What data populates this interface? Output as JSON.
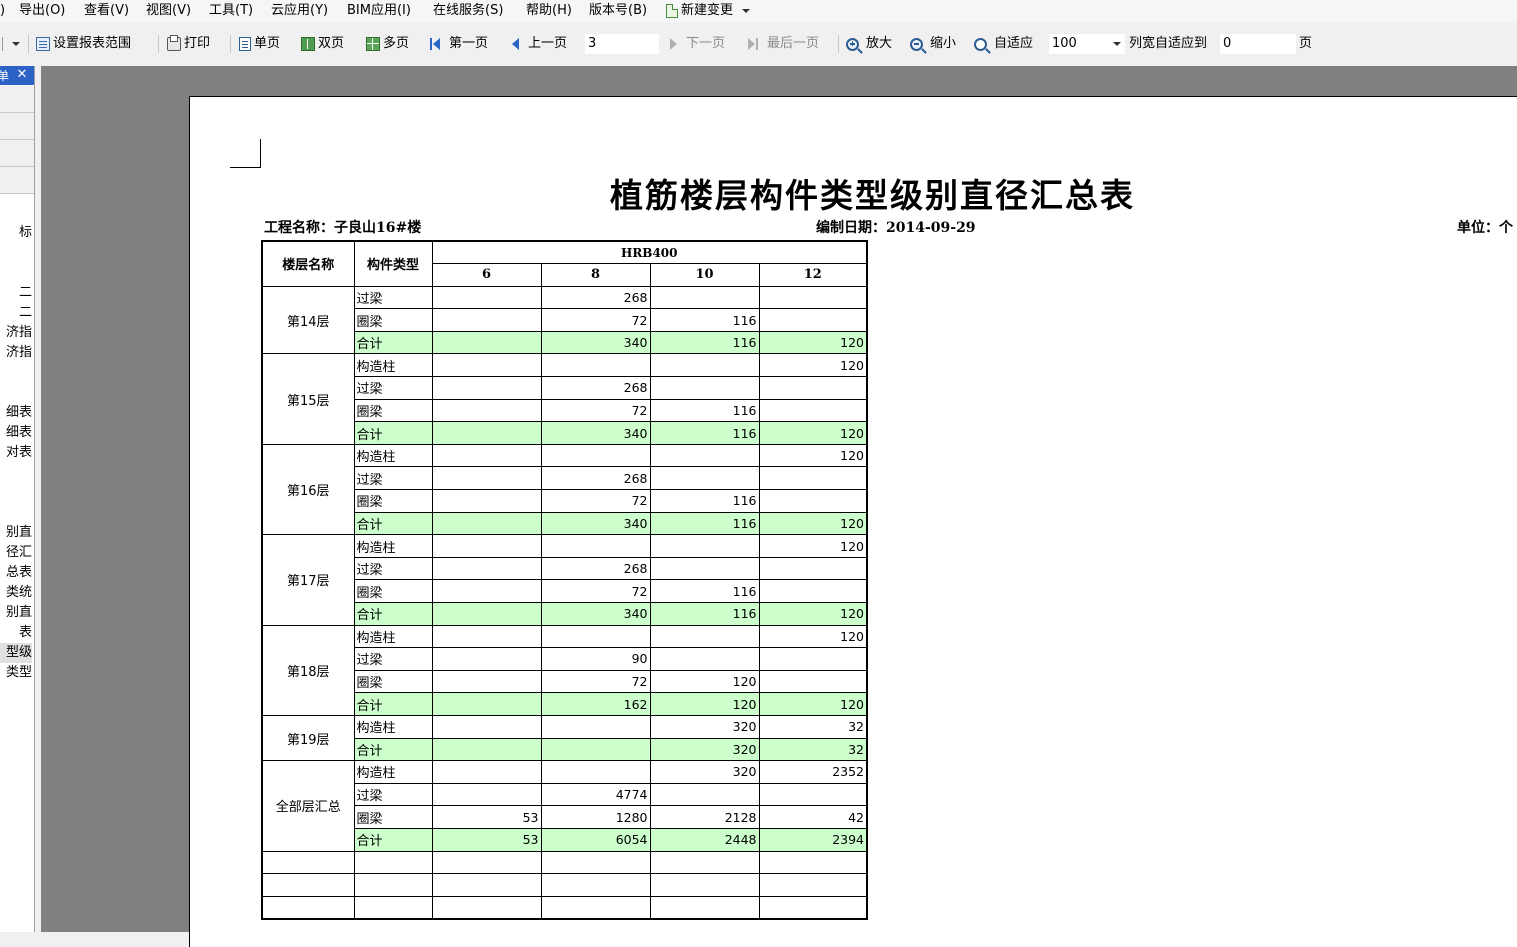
{
  "menu": [
    "导出(O)",
    "查看(V)",
    "视图(V)",
    "工具(T)",
    "云应用(Y)",
    "BIM应用(I)",
    "在线服务(S)",
    "帮助(H)",
    "版本号(B)",
    "新建变更"
  ],
  "menu_lead": ")",
  "toolbar": {
    "set_range": "设置报表范围",
    "print": "打印",
    "single": "单页",
    "double": "双页",
    "multi": "多页",
    "first": "第一页",
    "prev": "上一页",
    "page_value": "3",
    "next": "下一页",
    "last": "最后一页",
    "zoom_in": "放大",
    "zoom_out": "缩小",
    "fit": "自适应",
    "zoom_value": "100",
    "col_fit": "列宽自适应到",
    "col_fit_value": "0",
    "page_unit": "页"
  },
  "left_panel": {
    "title": "单",
    "close_icon": "close-icon",
    "items": [
      "标",
      "二",
      "二",
      "济指",
      "济指",
      "细表",
      "细表",
      "对表",
      "别直",
      "径汇",
      "总表",
      "类统",
      "别直",
      "表",
      "型级",
      "类型"
    ]
  },
  "report": {
    "title": "植筋楼层构件类型级别直径汇总表",
    "project_label": "工程名称：子良山16#楼",
    "date_label": "编制日期：2014-09-29",
    "unit_label": "单位：个",
    "headers": {
      "floor": "楼层名称",
      "type": "构件类型",
      "grade": "HRB400",
      "diameters": [
        "6",
        "8",
        "10",
        "12"
      ]
    },
    "groups": [
      {
        "floor": "第14层",
        "rows": [
          {
            "type": "过梁",
            "values": [
              "",
              "268",
              "",
              ""
            ],
            "sum": false
          },
          {
            "type": "圈梁",
            "values": [
              "",
              "72",
              "116",
              ""
            ],
            "sum": false
          },
          {
            "type": "合计",
            "values": [
              "",
              "340",
              "116",
              "120"
            ],
            "sum": true
          }
        ]
      },
      {
        "floor": "第15层",
        "rows": [
          {
            "type": "构造柱",
            "values": [
              "",
              "",
              "",
              "120"
            ],
            "sum": false
          },
          {
            "type": "过梁",
            "values": [
              "",
              "268",
              "",
              ""
            ],
            "sum": false
          },
          {
            "type": "圈梁",
            "values": [
              "",
              "72",
              "116",
              ""
            ],
            "sum": false
          },
          {
            "type": "合计",
            "values": [
              "",
              "340",
              "116",
              "120"
            ],
            "sum": true
          }
        ]
      },
      {
        "floor": "第16层",
        "rows": [
          {
            "type": "构造柱",
            "values": [
              "",
              "",
              "",
              "120"
            ],
            "sum": false
          },
          {
            "type": "过梁",
            "values": [
              "",
              "268",
              "",
              ""
            ],
            "sum": false
          },
          {
            "type": "圈梁",
            "values": [
              "",
              "72",
              "116",
              ""
            ],
            "sum": false
          },
          {
            "type": "合计",
            "values": [
              "",
              "340",
              "116",
              "120"
            ],
            "sum": true
          }
        ]
      },
      {
        "floor": "第17层",
        "rows": [
          {
            "type": "构造柱",
            "values": [
              "",
              "",
              "",
              "120"
            ],
            "sum": false
          },
          {
            "type": "过梁",
            "values": [
              "",
              "268",
              "",
              ""
            ],
            "sum": false
          },
          {
            "type": "圈梁",
            "values": [
              "",
              "72",
              "116",
              ""
            ],
            "sum": false
          },
          {
            "type": "合计",
            "values": [
              "",
              "340",
              "116",
              "120"
            ],
            "sum": true
          }
        ]
      },
      {
        "floor": "第18层",
        "rows": [
          {
            "type": "构造柱",
            "values": [
              "",
              "",
              "",
              "120"
            ],
            "sum": false
          },
          {
            "type": "过梁",
            "values": [
              "",
              "90",
              "",
              ""
            ],
            "sum": false
          },
          {
            "type": "圈梁",
            "values": [
              "",
              "72",
              "120",
              ""
            ],
            "sum": false
          },
          {
            "type": "合计",
            "values": [
              "",
              "162",
              "120",
              "120"
            ],
            "sum": true
          }
        ]
      },
      {
        "floor": "第19层",
        "rows": [
          {
            "type": "构造柱",
            "values": [
              "",
              "",
              "320",
              "32"
            ],
            "sum": false
          },
          {
            "type": "合计",
            "values": [
              "",
              "",
              "320",
              "32"
            ],
            "sum": true
          }
        ]
      },
      {
        "floor": "全部层汇总",
        "rows": [
          {
            "type": "构造柱",
            "values": [
              "",
              "",
              "320",
              "2352"
            ],
            "sum": false
          },
          {
            "type": "过梁",
            "values": [
              "",
              "4774",
              "",
              ""
            ],
            "sum": false
          },
          {
            "type": "圈梁",
            "values": [
              "53",
              "1280",
              "2128",
              "42"
            ],
            "sum": false
          },
          {
            "type": "合计",
            "values": [
              "53",
              "6054",
              "2448",
              "2394"
            ],
            "sum": true
          }
        ]
      }
    ],
    "blank_rows": 3
  },
  "colors": {
    "sum_row_bg": "#ccffcc",
    "viewer_bg": "#808080",
    "panel_header": "#2c62c6"
  }
}
